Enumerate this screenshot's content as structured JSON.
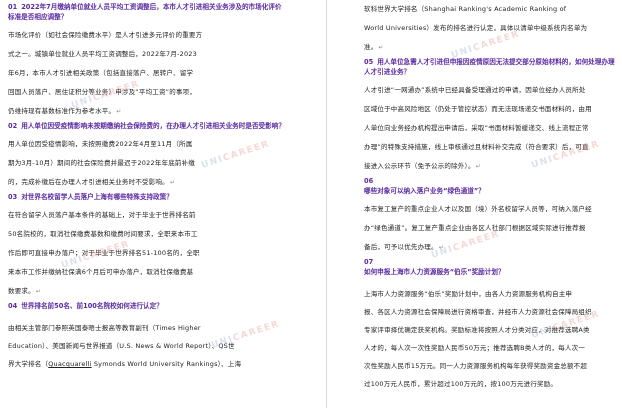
{
  "left": {
    "q1": {
      "num": "01",
      "text": "2022年7月缴纳单位就业人员平均工资调整后，本市人才引进相关业务涉及的市场化评价标准是否相应调整？"
    },
    "p1": [
      "市场化评价（如社会保险缴费水平）是人才引进多元评价的重要方",
      "式之一。城镇单位就业人员平均工资调整后，2022年7月-2023",
      "年6月，本市人才引进相关政策（包括直接落户、居转户、留学",
      "回国人员落户、居住证积分等业务）申涉及“平均工资”的事项，",
      "仍维持现有基数标准作为参考水平。"
    ],
    "q2": {
      "num": "02",
      "text": "用人单位因受疫情影响未按期缴纳社会保险费的，在办理人才引进相关业务时是否受影响？"
    },
    "p2": [
      "用人单位因受疫情影响，未按照缴费2022年4月至11月（所属",
      "期为3月-10月）期间的社会保险费并最迟于2022年年底前补缴",
      "的，完成补缴后在办理人才引进相关业务时不受影响。"
    ],
    "q3": {
      "num": "03",
      "text": "对世界名校留学人员落户上海有哪些特殊支持政策？"
    },
    "p3": [
      "在符合留学人员落户基本条件的基础上，对于毕业于世界排名前",
      "50名院校的，取消社保缴费基数和缴费时间要求，全职来本市工",
      "作后即可直接申办落户；对于毕业于世界排名51-100名的，全职",
      "来本市工作并缴纳社保满6个月后可申办落户，取消社保缴费基",
      "数要求。"
    ],
    "q4": {
      "num": "04",
      "text": "世界排名前50名、前100名院校如何进行认定？"
    },
    "p4": [
      "由相关主管部门参照英国泰晤士报高等教育副刊（Times Higher",
      "Education）、美国新闻与世界报道（U.S. News & World Report）、QS世",
      "界大学排名（Quacquarelli Symonds World University Rankings）、上海"
    ],
    "p4_link": "Quacquarelli"
  },
  "right": {
    "p_top": [
      "软科世界大学排名（Shanghai Ranking's Academic Ranking of",
      "World Universities）发布的排名进行认定，具体以清单中级系统内名单为",
      "准。"
    ],
    "q5": {
      "num": "05",
      "text": "用人单位急需人才引进但申报因疫情原因无法提交部分原始材料的，如何处理办理人才引进业务？"
    },
    "p5": [
      "人才引进“一网通办”系统中已经具备受理通过的申请，因单位经办人员所处",
      "区域位于中高风险地区（仍处于管控状态）而无法现场递交书面材料的，由用",
      "人单位向业务经办机构提出申请后，采取“书面材料暂缓递交、线上流程正常",
      "办理”的特殊支持措施，线上审核通过且材料补交完成（符合要求）后，可直",
      "接进入公示环节（免予公示的除外）。"
    ],
    "q6": {
      "num": "06",
      "text": "哪些对象可以纳入落户业务“绿色通道”？"
    },
    "p6": [
      "本市复工复产的重点企业人才以及国（境）外名校留学人员等，可纳入落户经",
      "办“绿色通道”。复工复产重点企业由各区人社部门根据区域实际进行推荐报",
      "备后，可予以优先办理。"
    ],
    "q7": {
      "num": "07",
      "text": "如何申报上海市人力资源服务“伯乐”奖励计划？"
    },
    "p7": [
      "上海市人力资源服务“伯乐”奖励计划中，由各人力资源服务机构自主申",
      "报、各区人力资源社会保障局进行资格审查，并经市人力资源社会保障局组织",
      "专家评审择优确定获奖机构。奖励标准将按照人才分类对应，对推荐选聘A类",
      "人才的，每人次一次性奖励人民币50万元；推荐选聘B类人才的，每人次一",
      "次性奖励人民币15万元。同一人力资源服务机构每年获得奖励资金总额不超",
      "过100万元人民币，累计超过100万元的，按100万元进行奖励。"
    ]
  },
  "paragraph_mark": "↵",
  "watermark": {
    "text_a": "UNI",
    "text_b": "CAREER"
  }
}
